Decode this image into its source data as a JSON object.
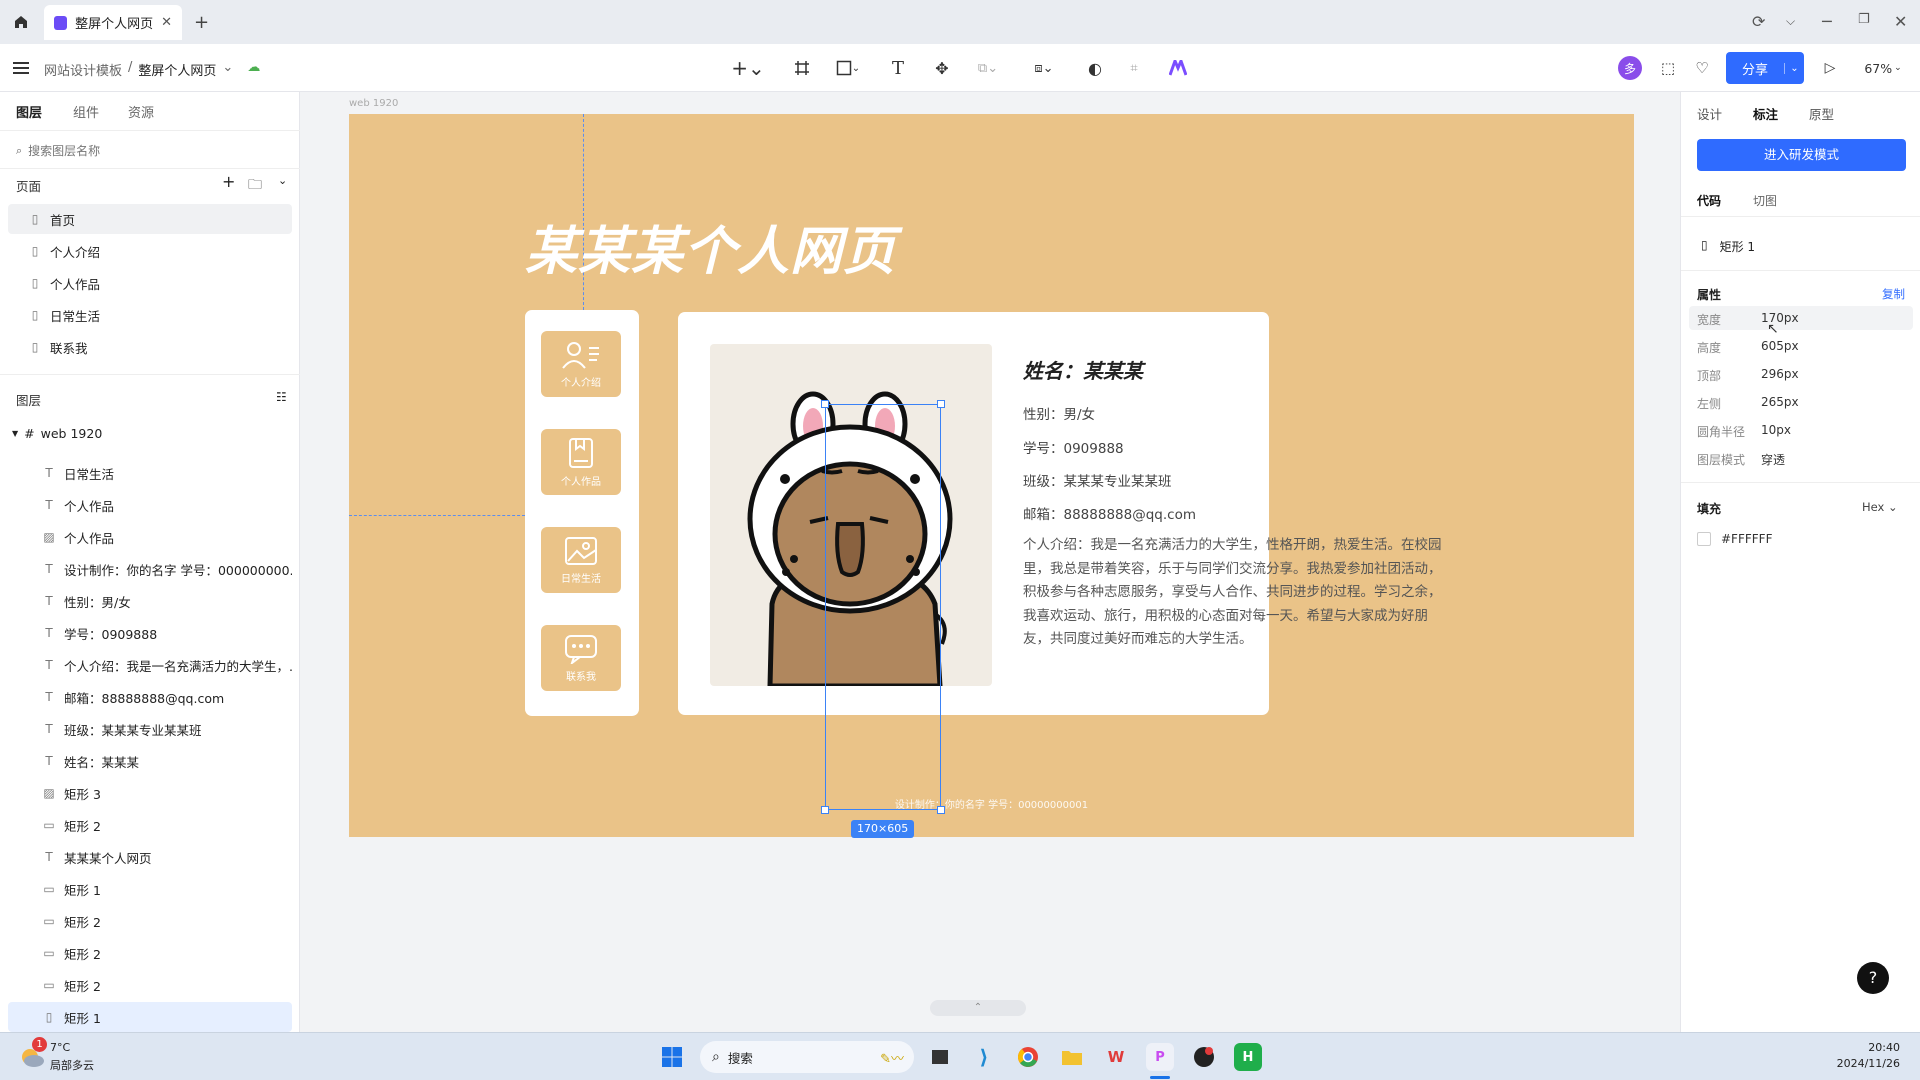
{
  "browser": {
    "tab_title": "整屏个人网页",
    "new_tab": "+"
  },
  "toolbar": {
    "breadcrumb_parent": "网站设计模板",
    "breadcrumb_sep": "/",
    "breadcrumb_current": "整屏个人网页",
    "share_label": "分享",
    "zoom": "67%",
    "avatar_letter": "多"
  },
  "left_panel": {
    "tabs": [
      "图层",
      "组件",
      "资源"
    ],
    "search_placeholder": "搜索图层名称",
    "pages_header": "页面",
    "pages": [
      "首页",
      "个人介绍",
      "个人作品",
      "日常生活",
      "联系我"
    ],
    "layers_header": "图层",
    "frame_name": "web 1920",
    "layers": [
      {
        "icon": "text-icon",
        "glyph": "T",
        "name": "日常生活"
      },
      {
        "icon": "text-icon",
        "glyph": "T",
        "name": "个人作品"
      },
      {
        "icon": "image-icon",
        "glyph": "▨",
        "name": "个人作品"
      },
      {
        "icon": "text-icon",
        "glyph": "T",
        "name": "设计制作：你的名字 学号：000000000..."
      },
      {
        "icon": "text-icon",
        "glyph": "T",
        "name": "性别：男/女"
      },
      {
        "icon": "text-icon",
        "glyph": "T",
        "name": "学号：0909888"
      },
      {
        "icon": "text-icon",
        "glyph": "T",
        "name": "个人介绍：我是一名充满活力的大学生，..."
      },
      {
        "icon": "text-icon",
        "glyph": "T",
        "name": "邮箱：88888888@qq.com"
      },
      {
        "icon": "text-icon",
        "glyph": "T",
        "name": "班级：某某某专业某某班"
      },
      {
        "icon": "text-icon",
        "glyph": "T",
        "name": "姓名：某某某"
      },
      {
        "icon": "image-icon",
        "glyph": "▨",
        "name": "矩形 3"
      },
      {
        "icon": "rect-icon",
        "glyph": "▭",
        "name": "矩形 2"
      },
      {
        "icon": "text-icon",
        "glyph": "T",
        "name": "某某某个人网页"
      },
      {
        "icon": "rect-icon",
        "glyph": "▭",
        "name": "矩形 1"
      },
      {
        "icon": "rect-icon",
        "glyph": "▭",
        "name": "矩形 2"
      },
      {
        "icon": "rect-icon",
        "glyph": "▭",
        "name": "矩形 2"
      },
      {
        "icon": "rect-icon",
        "glyph": "▭",
        "name": "矩形 2"
      },
      {
        "icon": "rect-v-icon",
        "glyph": "▯",
        "name": "矩形 1"
      }
    ]
  },
  "canvas": {
    "frame_label": "web 1920",
    "page_title": "某某某个人网页",
    "nav_buttons": [
      "个人介绍",
      "个人作品",
      "日常生活",
      "联系我"
    ],
    "profile": {
      "name": "姓名：某某某",
      "gender": "性别：男/女",
      "student_id": "学号：0909888",
      "class": "班级：某某某专业某某班",
      "email": "邮箱：88888888@qq.com",
      "intro": "个人介绍：我是一名充满活力的大学生，性格开朗，热爱生活。在校园里，我总是带着笑容，乐于与同学们交流分享。我热爱参加社团活动，积极参与各种志愿服务，享受与人合作、共同进步的过程。学习之余，我喜欢运动、旅行，用积极的心态面对每一天。希望与大家成为好朋友，共同度过美好而难忘的大学生活。"
    },
    "footer": "设计制作：你的名字  学号：00000000001",
    "selection_size": "170×605"
  },
  "right_panel": {
    "tabs": [
      "设计",
      "标注",
      "原型"
    ],
    "dev_mode_button": "进入研发模式",
    "subtabs": [
      "代码",
      "切图"
    ],
    "layer_name": "矩形 1",
    "props_header": "属性",
    "copy_label": "复制",
    "props": [
      {
        "label": "宽度",
        "value": "170px"
      },
      {
        "label": "高度",
        "value": "605px"
      },
      {
        "label": "顶部",
        "value": "296px"
      },
      {
        "label": "左侧",
        "value": "265px"
      },
      {
        "label": "圆角半径",
        "value": "10px"
      },
      {
        "label": "图层模式",
        "value": "穿透"
      }
    ],
    "fill_header": "填充",
    "fill_format": "Hex",
    "fill_value": "#FFFFFF"
  },
  "taskbar": {
    "weather_temp": "7°C",
    "weather_desc": "局部多云",
    "weather_badge": "1",
    "search_label": "搜索",
    "time": "20:40",
    "date": "2024/11/26"
  },
  "colors": {
    "artboard": "#eac388",
    "accent": "#2f6bff",
    "selection": "#3b82f6"
  }
}
